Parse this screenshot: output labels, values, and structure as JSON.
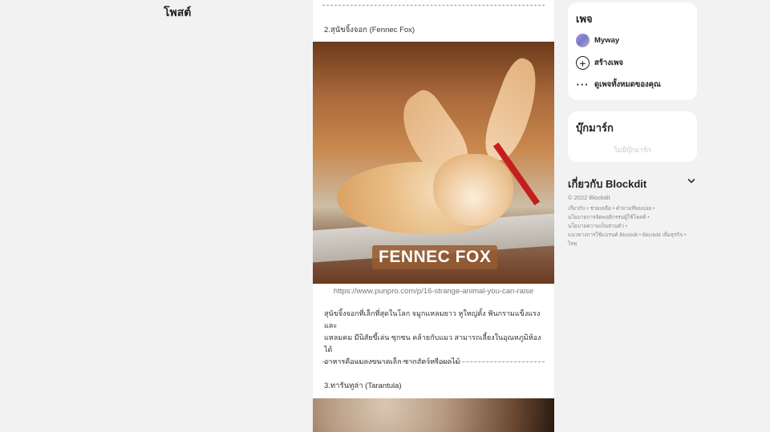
{
  "left": {
    "title": "โพสต์"
  },
  "feed": {
    "item2": {
      "heading": "2.สุนัขจิ้งจอก (Fennec Fox)",
      "image_caption": "FENNEC FOX",
      "source": "https://www.punpro.com/p/16-strange-animal-you-can-raise",
      "description_lines": [
        "สุนัขจิ้งจอกที่เล็กที่สุดในโลก จมูกแหลมยาว หูใหญ่ตั้ง ฟันกรามแข็งแรงและ",
        "แหลมคม มีนิสัยขี้เล่น ซุกซน คล้ายกับแมว สามารถเลี้ยงในอุณหภูมิห้องได้",
        "อาหารคือแมลงขนาดเล็ก ซากสัตว์หรือผลไม้"
      ]
    },
    "item3": {
      "heading": "3.ทารันทูล่า (Tarantula)"
    }
  },
  "sidebar": {
    "pages": {
      "title": "เพจ",
      "items": [
        {
          "label": "Myway",
          "icon": "avatar"
        },
        {
          "label": "สร้างเพจ",
          "icon": "plus-circle-icon"
        },
        {
          "label": "ดูเพจทั้งหมดของคุณ",
          "icon": "more-dots-icon"
        }
      ]
    },
    "bookmarks": {
      "title": "บุ๊กมาร์ก",
      "empty": "ไม่มีบุ๊กมาร์ก"
    },
    "about": {
      "title": "เกี่ยวกับ Blockdit",
      "copyright": "© 2022 Blockdit",
      "links": [
        "เกี่ยวกับ • ช่วยเหลือ • คำถามที่พบบ่อย •",
        "นโยบายการจัดพฤติกรรมผู้ใช้โพสต์ •",
        "นโยบายความเป็นส่วนตัว •",
        "แนวทางการใช้แบรนด์ Blockdit • Blockdit เพื่อธุรกิจ •",
        "ไทย"
      ]
    }
  },
  "colors": {
    "strap": "#c41e1e",
    "badge": "#965c32",
    "page_bg": "#f2f2f2"
  }
}
